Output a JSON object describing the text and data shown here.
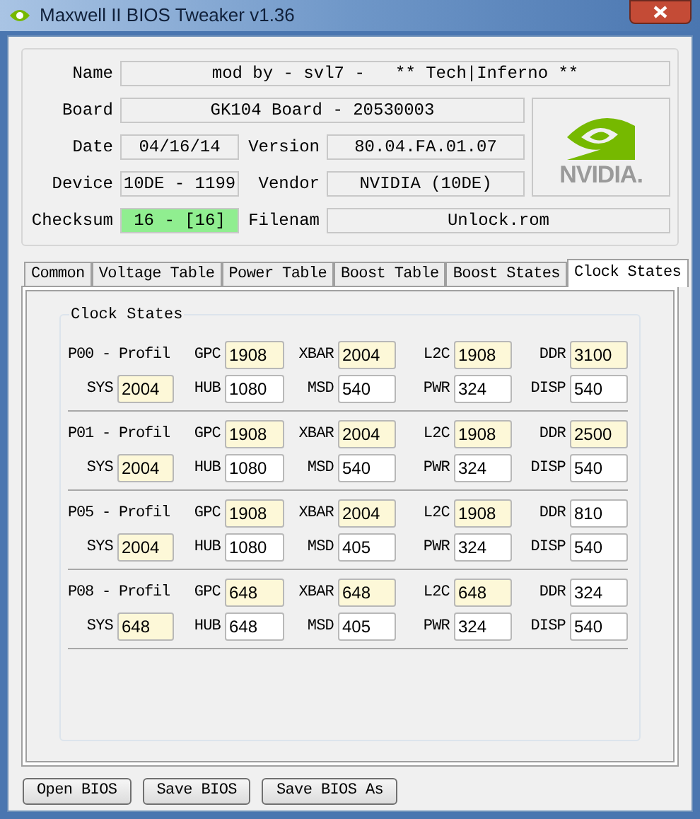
{
  "window": {
    "title": "Maxwell II BIOS Tweaker v1.36"
  },
  "info": {
    "name": {
      "label": "Name",
      "value": "mod by - svl7 -   ** Tech|Inferno **"
    },
    "board": {
      "label": "Board",
      "value": "GK104 Board - 20530003"
    },
    "date": {
      "label": "Date",
      "value": "04/16/14"
    },
    "version": {
      "label": "Version",
      "value": "80.04.FA.01.07"
    },
    "device": {
      "label": "Device",
      "value": "10DE - 1199"
    },
    "vendor": {
      "label": "Vendor",
      "value": "NVIDIA (10DE)"
    },
    "checksum": {
      "label": "Checksum",
      "value": "16 - [16]",
      "valid": true
    },
    "filename": {
      "label": "Filenam",
      "value": "Unlock.rom"
    },
    "logo": {
      "text": "NVIDIA."
    }
  },
  "tabs": [
    {
      "label": "Common",
      "selected": false
    },
    {
      "label": "Voltage Table",
      "selected": false
    },
    {
      "label": "Power Table",
      "selected": false
    },
    {
      "label": "Boost Table",
      "selected": false
    },
    {
      "label": "Boost States",
      "selected": false
    },
    {
      "label": "Clock States",
      "selected": true
    }
  ],
  "group": {
    "title": "Clock States"
  },
  "profiles": [
    {
      "title": "P00 - Profil",
      "row_1": [
        {
          "label": "GPC",
          "value": "1908",
          "highlighted": true
        },
        {
          "label": "XBAR",
          "value": "2004",
          "highlighted": true
        },
        {
          "label": "L2C",
          "value": "1908",
          "highlighted": true
        },
        {
          "label": "DDR",
          "value": "3100",
          "highlighted": true
        }
      ],
      "row_2": [
        {
          "label": "SYS",
          "value": "2004",
          "highlighted": true
        },
        {
          "label": "HUB",
          "value": "1080",
          "highlighted": false
        },
        {
          "label": "MSD",
          "value": "540",
          "highlighted": false
        },
        {
          "label": "PWR",
          "value": "324",
          "highlighted": false
        },
        {
          "label": "DISP",
          "value": "540",
          "highlighted": false
        }
      ]
    },
    {
      "title": "P01 - Profil",
      "row_1": [
        {
          "label": "GPC",
          "value": "1908",
          "highlighted": true
        },
        {
          "label": "XBAR",
          "value": "2004",
          "highlighted": true
        },
        {
          "label": "L2C",
          "value": "1908",
          "highlighted": true
        },
        {
          "label": "DDR",
          "value": "2500",
          "highlighted": true
        }
      ],
      "row_2": [
        {
          "label": "SYS",
          "value": "2004",
          "highlighted": true
        },
        {
          "label": "HUB",
          "value": "1080",
          "highlighted": false
        },
        {
          "label": "MSD",
          "value": "540",
          "highlighted": false
        },
        {
          "label": "PWR",
          "value": "324",
          "highlighted": false
        },
        {
          "label": "DISP",
          "value": "540",
          "highlighted": false
        }
      ]
    },
    {
      "title": "P05 - Profil",
      "row_1": [
        {
          "label": "GPC",
          "value": "1908",
          "highlighted": true
        },
        {
          "label": "XBAR",
          "value": "2004",
          "highlighted": true
        },
        {
          "label": "L2C",
          "value": "1908",
          "highlighted": true
        },
        {
          "label": "DDR",
          "value": "810",
          "highlighted": false
        }
      ],
      "row_2": [
        {
          "label": "SYS",
          "value": "2004",
          "highlighted": true
        },
        {
          "label": "HUB",
          "value": "1080",
          "highlighted": false
        },
        {
          "label": "MSD",
          "value": "405",
          "highlighted": false
        },
        {
          "label": "PWR",
          "value": "324",
          "highlighted": false
        },
        {
          "label": "DISP",
          "value": "540",
          "highlighted": false
        }
      ]
    },
    {
      "title": "P08 - Profil",
      "row_1": [
        {
          "label": "GPC",
          "value": "648",
          "highlighted": true
        },
        {
          "label": "XBAR",
          "value": "648",
          "highlighted": true
        },
        {
          "label": "L2C",
          "value": "648",
          "highlighted": true
        },
        {
          "label": "DDR",
          "value": "324",
          "highlighted": false
        }
      ],
      "row_2": [
        {
          "label": "SYS",
          "value": "648",
          "highlighted": true
        },
        {
          "label": "HUB",
          "value": "648",
          "highlighted": false
        },
        {
          "label": "MSD",
          "value": "405",
          "highlighted": false
        },
        {
          "label": "PWR",
          "value": "324",
          "highlighted": false
        },
        {
          "label": "DISP",
          "value": "540",
          "highlighted": false
        }
      ]
    }
  ],
  "buttons": [
    "Open BIOS",
    "Save BIOS",
    "Save BIOS As"
  ]
}
